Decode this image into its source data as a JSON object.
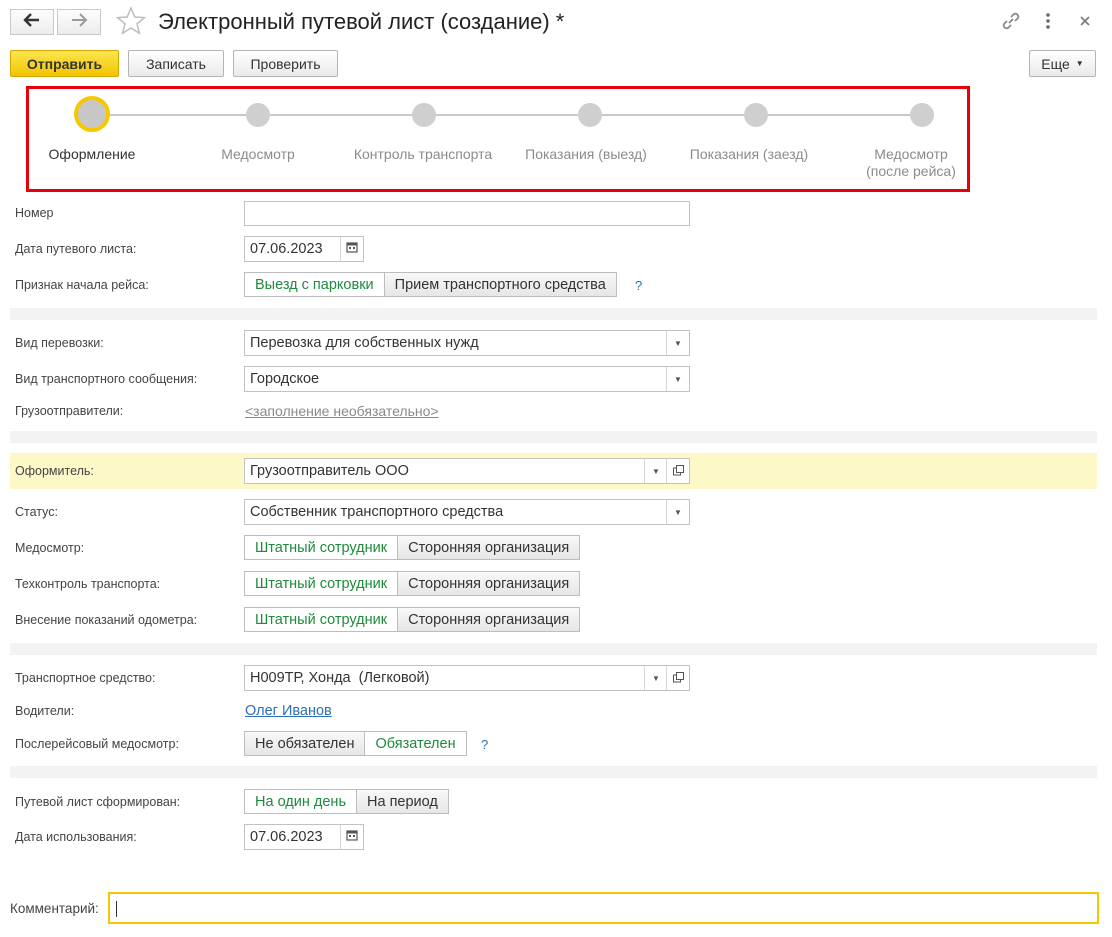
{
  "header": {
    "title": "Электронный путевой лист (создание) *"
  },
  "toolbar": {
    "send": "Отправить",
    "save": "Записать",
    "check": "Проверить",
    "more": "Еще"
  },
  "steps": [
    {
      "label": "Оформление",
      "active": true
    },
    {
      "label": "Медосмотр"
    },
    {
      "label": "Контроль транспорта"
    },
    {
      "label": "Показания (выезд)"
    },
    {
      "label": "Показания (заезд)"
    },
    {
      "label_line1": "Медосмотр",
      "label_line2": "(после рейса)"
    }
  ],
  "form": {
    "number_label": "Номер",
    "number_value": "",
    "date_label": "Дата путевого листа:",
    "date_value": "07.06.2023",
    "trip_start_label": "Признак начала рейса:",
    "trip_start_options": [
      "Выезд с парковки",
      "Прием транспортного средства"
    ],
    "transport_kind_label": "Вид перевозки:",
    "transport_kind_value": "Перевозка для собственных нужд",
    "message_kind_label": "Вид транспортного сообщения:",
    "message_kind_value": "Городское",
    "shippers_label": "Грузоотправители:",
    "shippers_link": "<заполнение необязательно>",
    "issuer_label": "Оформитель:",
    "issuer_value": "Грузоотправитель ООО",
    "status_label": "Статус:",
    "status_value": "Собственник транспортного средства",
    "medcheck_label": "Медосмотр:",
    "techcontrol_label": "Техконтроль транспорта:",
    "odometer_label": "Внесение показаний одометра:",
    "staff_option": "Штатный сотрудник",
    "third_party_option": "Сторонняя организация",
    "vehicle_label": "Транспортное средство:",
    "vehicle_value": "Н009ТР, Хонда  (Легковой)",
    "drivers_label": "Водители:",
    "drivers_link": "Олег Иванов",
    "post_med_label": "Послерейсовый медосмотр:",
    "post_med_options": [
      "Не обязателен",
      "Обязателен"
    ],
    "formed_label": "Путевой лист сформирован:",
    "formed_options": [
      "На один день",
      "На период"
    ],
    "use_date_label": "Дата использования:",
    "use_date_value": "07.06.2023",
    "comment_label": "Комментарий:",
    "comment_value": "",
    "help_mark": "?"
  },
  "colors": {
    "primary_button": "#f2c400",
    "active_option": "#1e8a3d",
    "link": "#2b6fb6",
    "step_frame": "#e8000b",
    "highlight_row": "#fdf8c8"
  }
}
